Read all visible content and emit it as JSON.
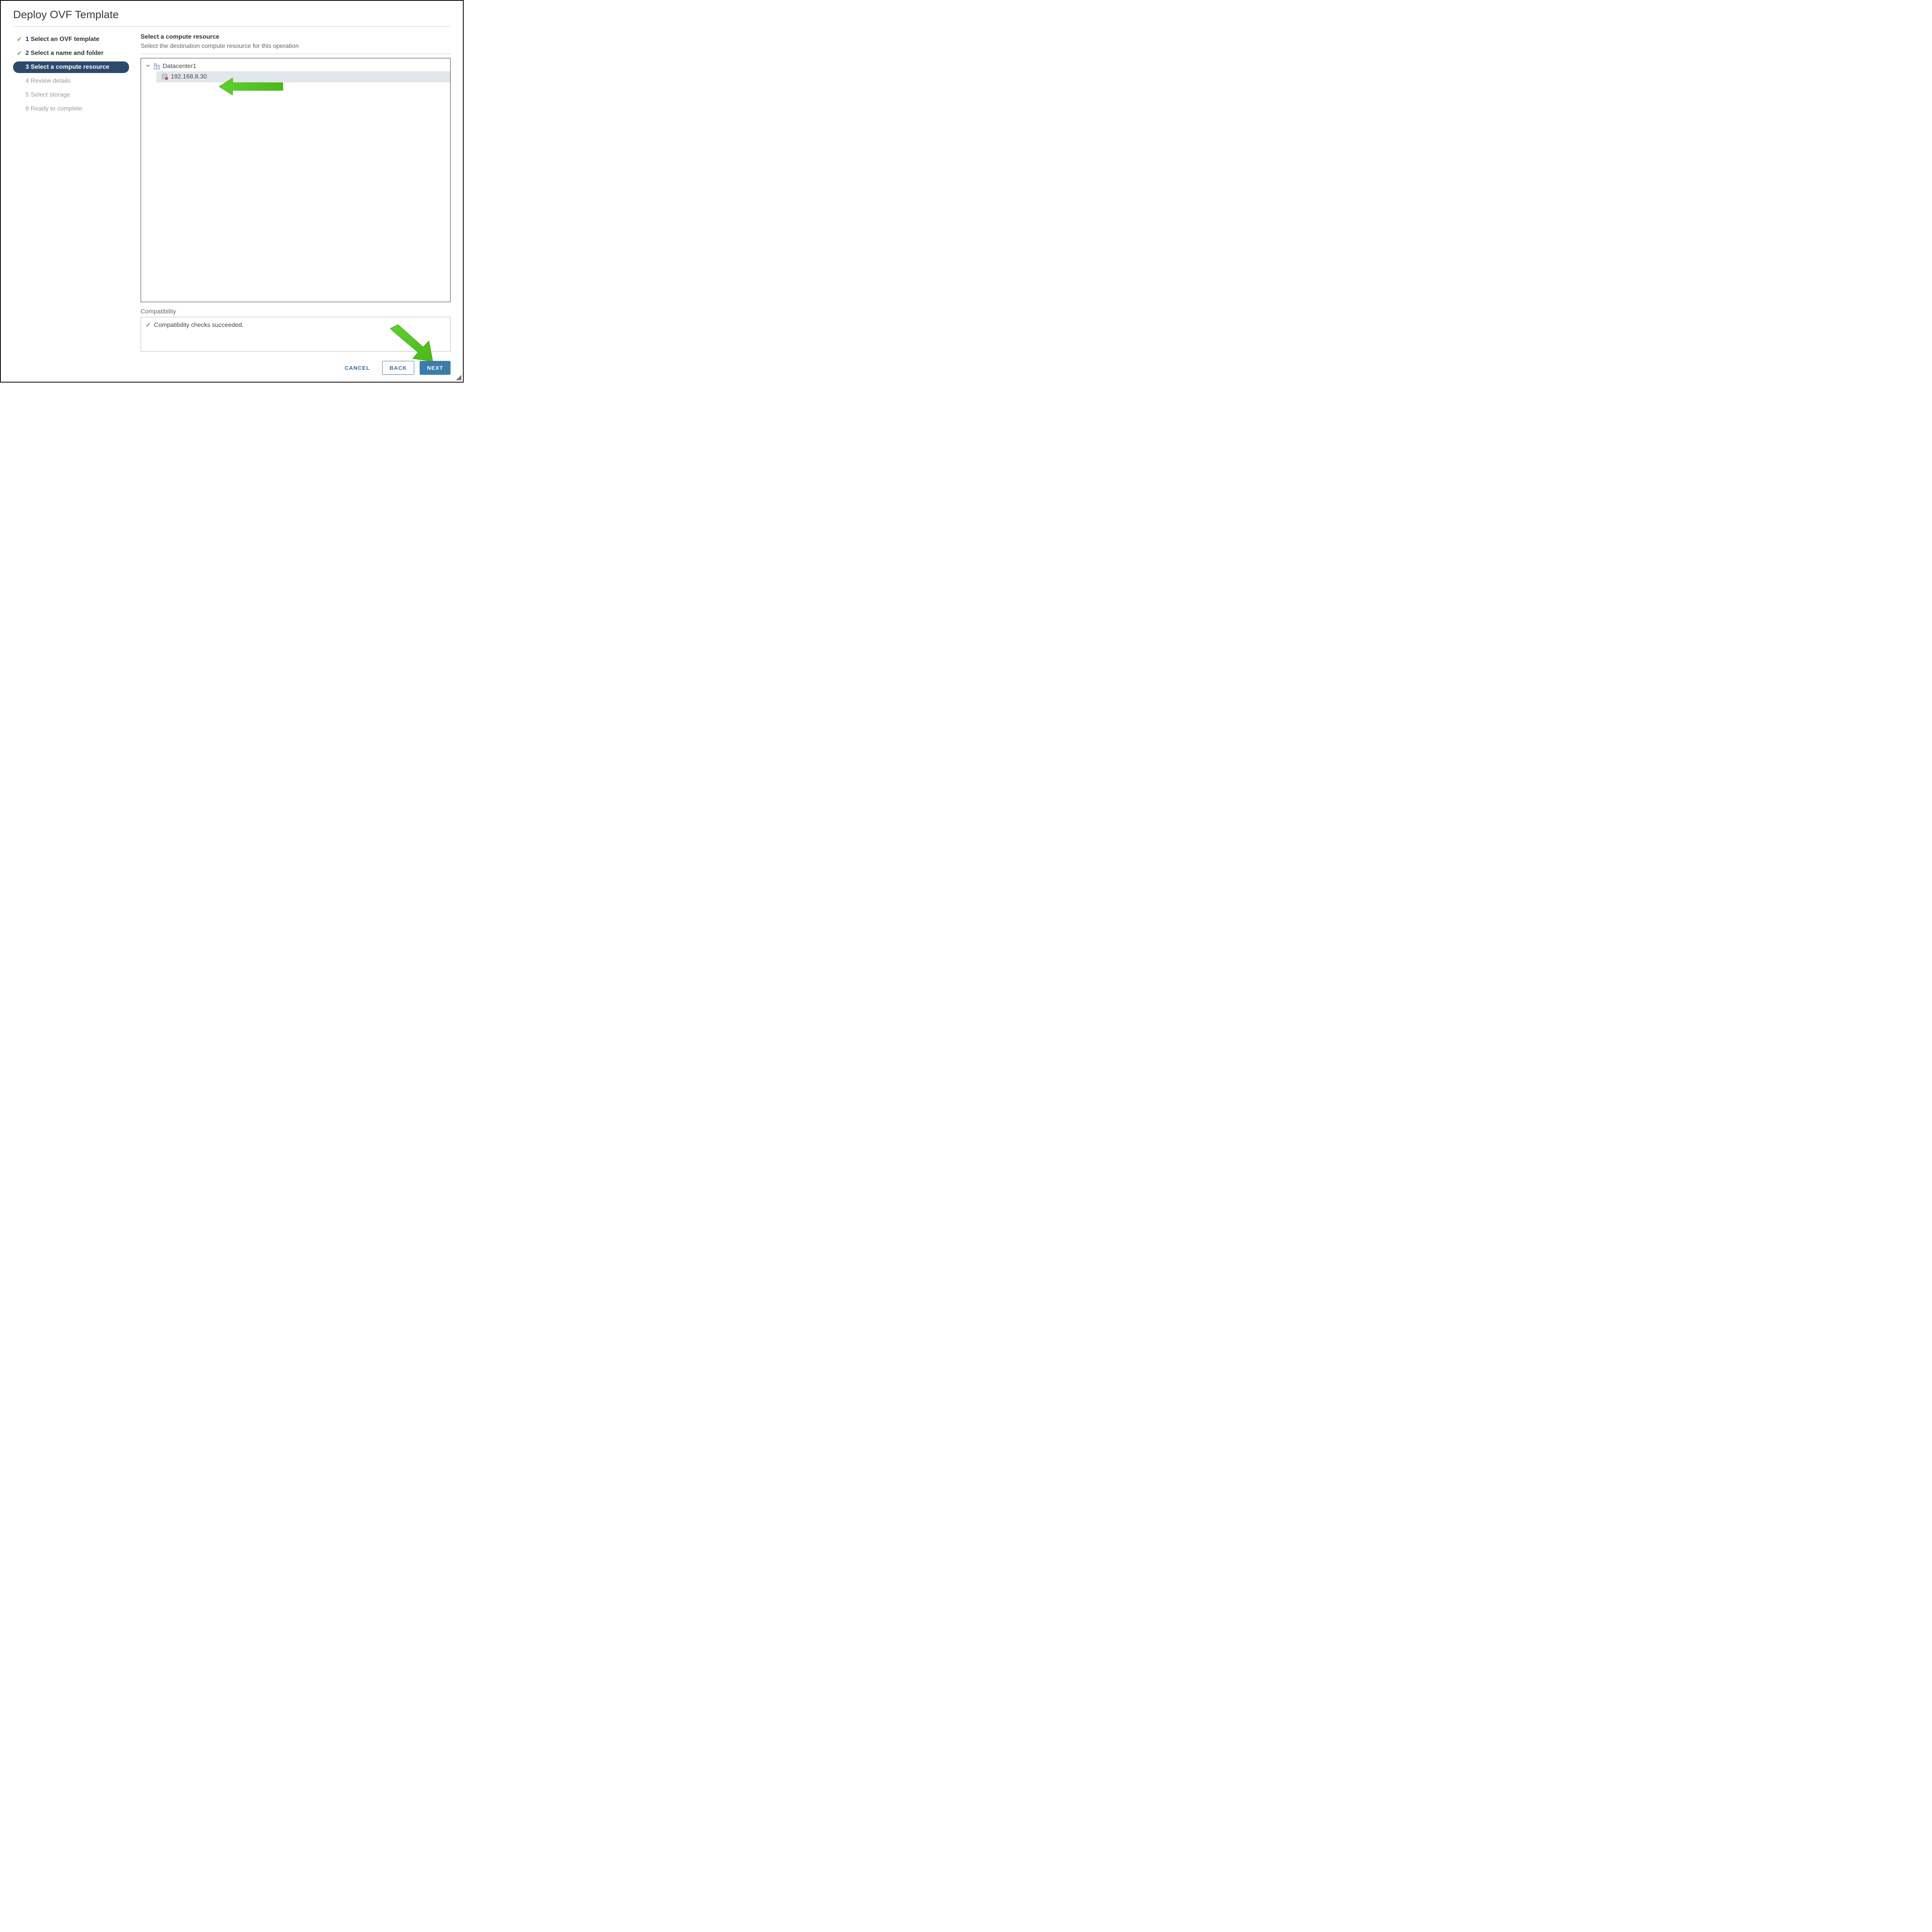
{
  "title": "Deploy OVF Template",
  "steps": [
    {
      "label": "1 Select an OVF template",
      "state": "completed"
    },
    {
      "label": "2 Select a name and folder",
      "state": "completed"
    },
    {
      "label": "3 Select a compute resource",
      "state": "active"
    },
    {
      "label": "4 Review details",
      "state": "pending"
    },
    {
      "label": "5 Select storage",
      "state": "pending"
    },
    {
      "label": "6 Ready to complete",
      "state": "pending"
    }
  ],
  "section": {
    "title": "Select a compute resource",
    "subtitle": "Select the destination compute resource for this operation"
  },
  "tree": {
    "root_label": "Datacenter1",
    "host_label": "192.168.8.30"
  },
  "compatibility": {
    "label": "Compatibility",
    "message": "Compatibility checks succeeded."
  },
  "buttons": {
    "cancel": "CANCEL",
    "back": "BACK",
    "next": "NEXT"
  }
}
